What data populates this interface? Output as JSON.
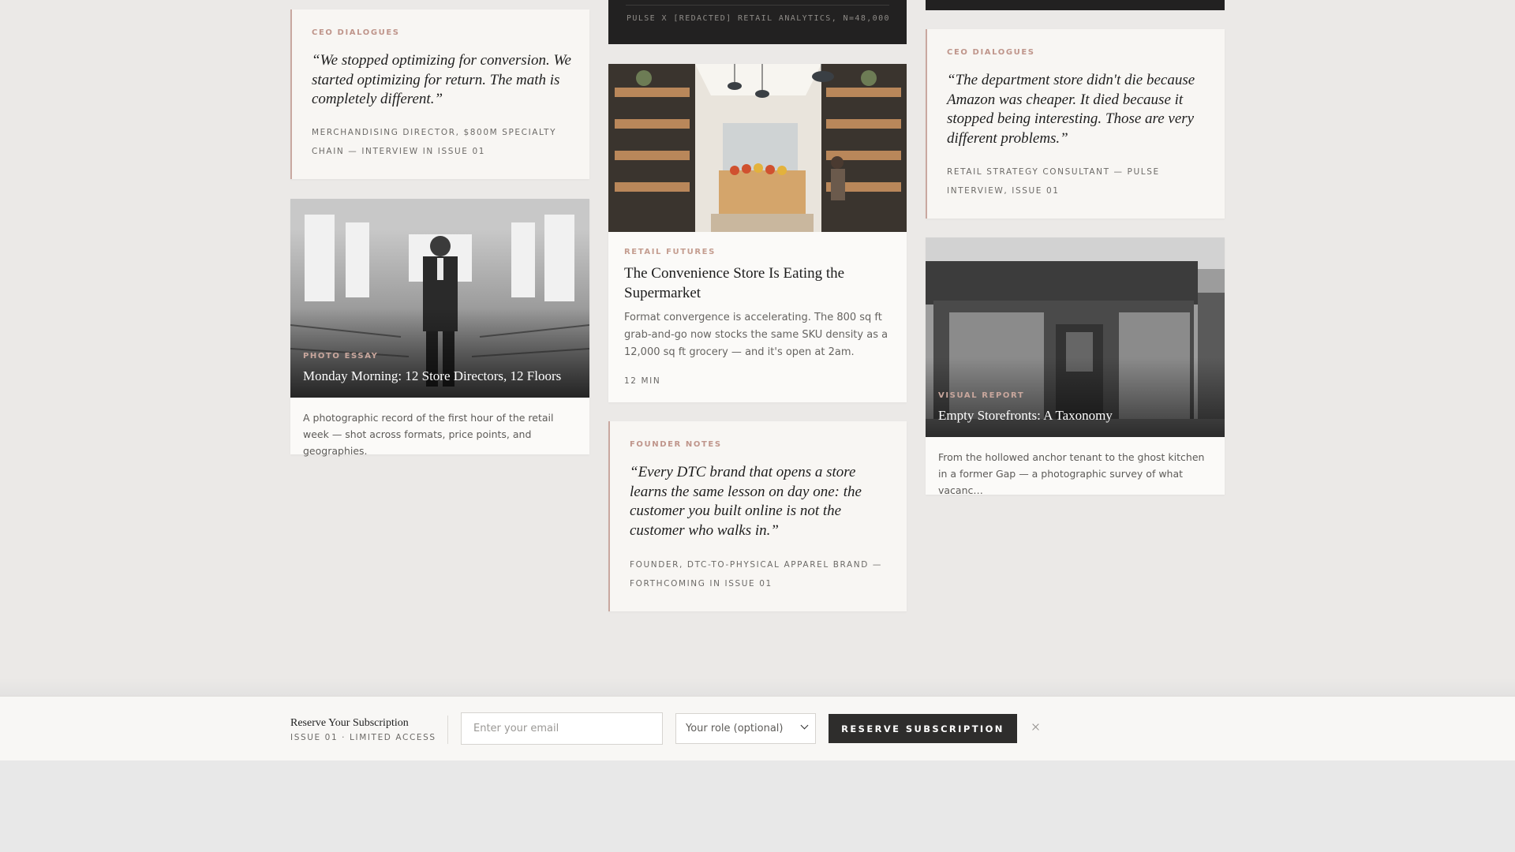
{
  "colors": {
    "page_bg": "#ebe9e7",
    "card_bg": "#f8f6f3",
    "accent": "#c49d90",
    "dark": "#222121",
    "button": "#2e2d2c"
  },
  "column_left": {
    "quote": {
      "label": "CEO DIALOGUES",
      "text": "“We stopped optimizing for conversion. We started optimizing for return. The math is completely different.”",
      "attribution": "MERCHANDISING DIRECTOR, $800M SPECIALTY CHAIN — INTERVIEW IN ISSUE 01"
    },
    "photo_essay": {
      "label": "PHOTO ESSAY",
      "title": "Monday Morning: 12 Store Directors, 12 Floors",
      "description": "A photographic record of the first hour of the retail week — shot across formats, price points, and geographies.",
      "image": "store-director-photo"
    }
  },
  "column_middle": {
    "dark_strip": {
      "source_line": "PULSE X [REDACTED] RETAIL ANALYTICS, N=48,000"
    },
    "article": {
      "label": "RETAIL FUTURES",
      "title": "The Convenience Store Is Eating the Supermarket",
      "description": "Format convergence is accelerating. The 800 sq ft grab-and-go now stocks the same SKU density as a 12,000 sq ft grocery — and it's open at 2am.",
      "read_time": "12 MIN",
      "image": "convenience-store-photo"
    },
    "quote": {
      "label": "FOUNDER NOTES",
      "text": "“Every DTC brand that opens a store learns the same lesson on day one: the customer you built online is not the customer who walks in.”",
      "attribution": "FOUNDER, DTC-TO-PHYSICAL APPAREL BRAND — FORTHCOMING IN ISSUE 01"
    }
  },
  "column_right": {
    "quote": {
      "label": "CEO DIALOGUES",
      "text": "“The department store didn't die because Amazon was cheaper. It died because it stopped being interesting. Those are very different problems.”",
      "attribution": "RETAIL STRATEGY CONSULTANT — PULSE INTERVIEW, ISSUE 01"
    },
    "visual_report": {
      "label": "VISUAL REPORT",
      "title": "Empty Storefronts: A Taxonomy",
      "description": "From the hollowed anchor tenant to the ghost kitchen in a former Gap — a photographic survey of what vacanc…",
      "image": "empty-storefront-photo"
    }
  },
  "subscription_bar": {
    "title": "Reserve Your Subscription",
    "subtitle": "ISSUE 01 · LIMITED ACCESS",
    "email_placeholder": "Enter your email",
    "role_selected": "Your role (optional)",
    "button_label": "RESERVE SUBSCRIPTION",
    "close_icon": "close-icon"
  }
}
